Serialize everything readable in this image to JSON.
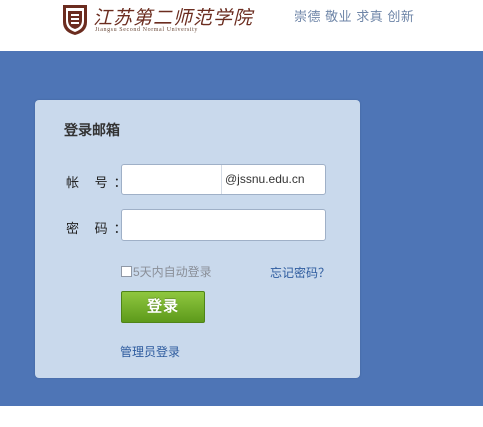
{
  "header": {
    "school_name_cn": "江苏第二师范学院",
    "school_name_en": "Jiangsu Second Normal University",
    "motto": "崇德 敬业 求真 创新"
  },
  "login": {
    "title": "登录邮箱",
    "account_label": "帐 号：",
    "account_value": "",
    "domain_suffix": "@jssnu.edu.cn",
    "password_label": "密 码：",
    "password_value": "",
    "auto_login_label": "5天内自动登录",
    "auto_login_checked": false,
    "forgot_password": "忘记密码？",
    "login_button": "登录",
    "admin_login": "管理员登录"
  },
  "colors": {
    "band": "#4e75b6",
    "panel": "#c9d9ec",
    "button": "#6aab24",
    "link": "#2d5b9e"
  },
  "icons": {
    "logo": "university-emblem-icon"
  }
}
